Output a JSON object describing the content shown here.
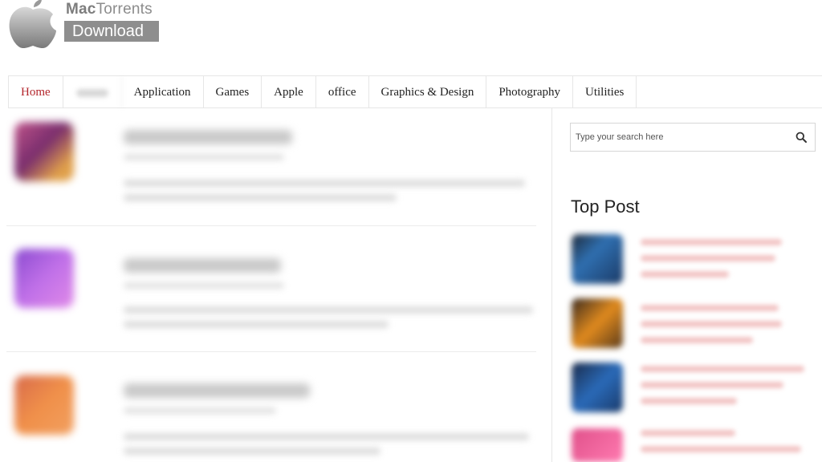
{
  "brand": {
    "name_part1": "Mac",
    "name_part2": "Torrents",
    "download_label": "Download"
  },
  "nav": {
    "items": [
      {
        "label": "Home",
        "active": true
      },
      {
        "label": "",
        "blurred": true
      },
      {
        "label": "Application"
      },
      {
        "label": "Games"
      },
      {
        "label": "Apple"
      },
      {
        "label": "office"
      },
      {
        "label": "Graphics & Design"
      },
      {
        "label": "Photography"
      },
      {
        "label": "Utilities"
      }
    ]
  },
  "search": {
    "placeholder": "Type your search here",
    "value": "",
    "icon": "search-icon"
  },
  "sidebar": {
    "top_post_title": "Top Post"
  },
  "colors": {
    "accent": "#b3262c",
    "nav_border": "#e6e6e6",
    "logo_gray": "#8e8e8e"
  }
}
